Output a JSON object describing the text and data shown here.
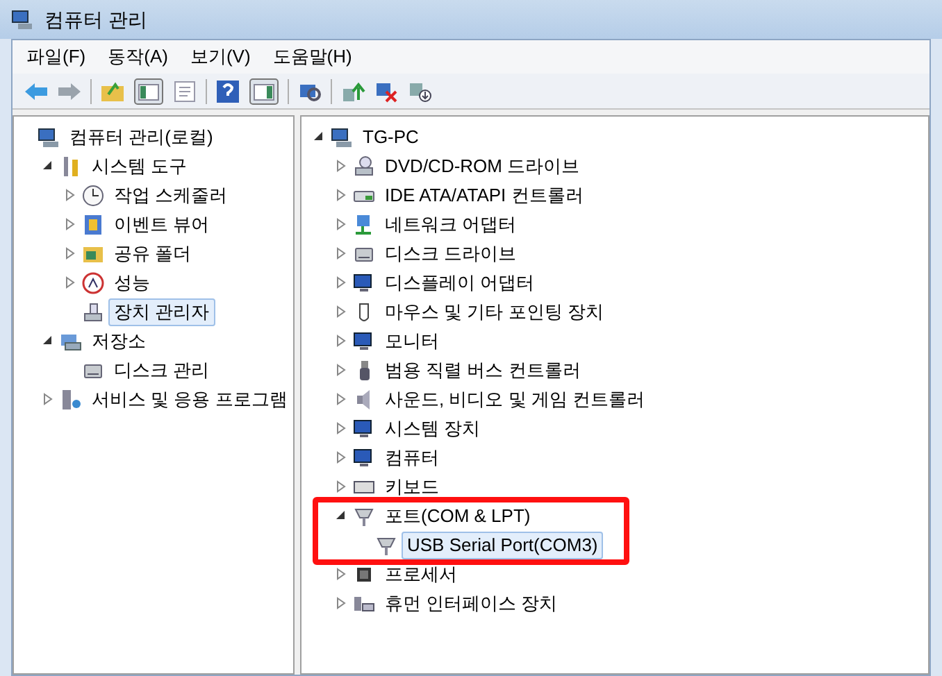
{
  "window": {
    "title": "컴퓨터 관리"
  },
  "menu": [
    "파일(F)",
    "동작(A)",
    "보기(V)",
    "도움말(H)"
  ],
  "left_tree": [
    {
      "label": "컴퓨터 관리(로컬)",
      "children": [
        {
          "label": "시스템 도구",
          "expanded": true,
          "children": [
            {
              "label": "작업 스케줄러",
              "expanded": false
            },
            {
              "label": "이벤트 뷰어",
              "expanded": false
            },
            {
              "label": "공유 폴더",
              "expanded": false
            },
            {
              "label": "성능",
              "expanded": false
            },
            {
              "label": "장치 관리자",
              "selected": true
            }
          ]
        },
        {
          "label": "저장소",
          "expanded": true,
          "children": [
            {
              "label": "디스크 관리",
              "selected": false
            }
          ]
        },
        {
          "label": "서비스 및 응용 프로그램",
          "expanded": false
        }
      ]
    }
  ],
  "right_tree": [
    {
      "label": "TG-PC",
      "expanded": true,
      "children": [
        {
          "label": "DVD/CD-ROM 드라이브",
          "expanded": false
        },
        {
          "label": "IDE ATA/ATAPI 컨트롤러",
          "expanded": false
        },
        {
          "label": "네트워크 어댑터",
          "expanded": false
        },
        {
          "label": "디스크 드라이브",
          "expanded": false
        },
        {
          "label": "디스플레이 어댑터",
          "expanded": false
        },
        {
          "label": "마우스 및 기타 포인팅 장치",
          "expanded": false
        },
        {
          "label": "모니터",
          "expanded": false
        },
        {
          "label": "범용 직렬 버스 컨트롤러",
          "expanded": false
        },
        {
          "label": "사운드, 비디오 및 게임 컨트롤러",
          "expanded": false
        },
        {
          "label": "시스템 장치",
          "expanded": false
        },
        {
          "label": "컴퓨터",
          "expanded": false
        },
        {
          "label": "키보드",
          "expanded": false
        },
        {
          "label": "포트(COM & LPT)",
          "expanded": true,
          "highlight": true,
          "children": [
            {
              "label": "USB Serial Port(COM3)",
              "selected": true
            }
          ]
        },
        {
          "label": "프로세서",
          "expanded": false
        },
        {
          "label": "휴먼 인터페이스 장치",
          "expanded": false
        }
      ]
    }
  ]
}
